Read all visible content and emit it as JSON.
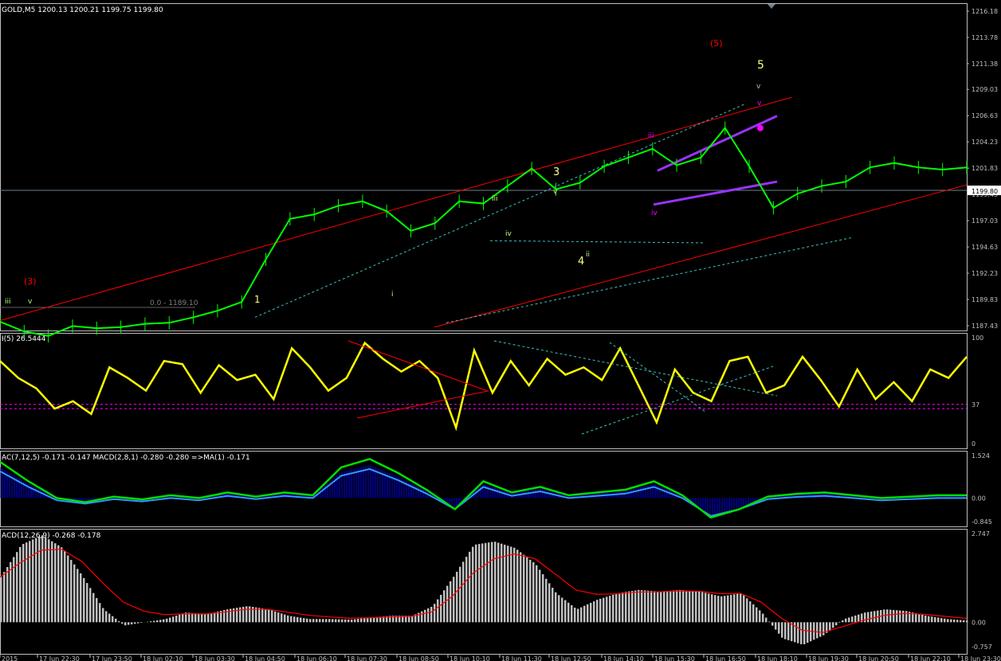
{
  "window": {
    "symbol_header": "GOLD,M5  1200.13 1200.21 1199.75 1199.80",
    "current_price_tag": "1199.80"
  },
  "colors": {
    "background": "#000000",
    "frame": "#c0c0c0",
    "candles": "#00ff00",
    "price_line": "#708090",
    "channel": "#ff0000",
    "dotted_trend": "#40c0c0",
    "wedge": "#9933ff",
    "rsi_line": "#ffff00",
    "rsi_level": "#ff00ff",
    "macd_signal": "#00e000",
    "macd_fast": "#3399ff",
    "macd_hist": "#0000ff",
    "macd2_hist": "#c0c0c0",
    "macd2_signal": "#ff0000"
  },
  "chart_data": [
    {
      "type": "line",
      "panel": "price",
      "ylim": [
        1187.43,
        1216.18
      ],
      "y_ticks": [
        "1216.18",
        "1213.78",
        "1211.38",
        "1209.03",
        "1206.63",
        "1204.23",
        "1201.83",
        "1199.43",
        "1197.03",
        "1194.63",
        "1192.23",
        "1189.83",
        "1187.43"
      ],
      "x": [
        0,
        5,
        10,
        15,
        20,
        25,
        30,
        35,
        40,
        45,
        50,
        55,
        60,
        65,
        70,
        75,
        80,
        85,
        90,
        95,
        100,
        105,
        110,
        115,
        120,
        125,
        130,
        135,
        140,
        145,
        150,
        155,
        160,
        165,
        170,
        175,
        180,
        185,
        190,
        195,
        200
      ],
      "close": [
        1187.8,
        1186.9,
        1186.5,
        1187.4,
        1187.2,
        1187.3,
        1187.6,
        1187.7,
        1188.2,
        1188.8,
        1189.6,
        1193.5,
        1197.2,
        1197.6,
        1198.4,
        1198.8,
        1197.9,
        1196.1,
        1196.8,
        1198.8,
        1198.6,
        1200.2,
        1201.8,
        1199.9,
        1200.5,
        1202.0,
        1202.8,
        1203.6,
        1202.1,
        1202.8,
        1205.5,
        1202.0,
        1198.2,
        1199.5,
        1200.2,
        1200.6,
        1201.9,
        1202.3,
        1201.9,
        1201.7,
        1201.9
      ],
      "fib_label": "0.0 - 1189.10",
      "wave_labels": [
        "(3)",
        "(5)",
        "1",
        "3",
        "4",
        "5",
        "i",
        "ii",
        "iii",
        "iv",
        "v"
      ]
    },
    {
      "type": "line",
      "panel": "rsi",
      "title": "I(5) 26.5444",
      "ylim": [
        0,
        100
      ],
      "y_ticks": [
        "100",
        "37",
        "0"
      ],
      "levels": [
        37,
        33
      ],
      "values": [
        78,
        62,
        52,
        33,
        40,
        28,
        72,
        62,
        50,
        78,
        75,
        48,
        74,
        60,
        65,
        42,
        90,
        72,
        50,
        62,
        95,
        80,
        68,
        78,
        62,
        15,
        88,
        48,
        78,
        55,
        80,
        65,
        72,
        60,
        90,
        55,
        20,
        70,
        48,
        40,
        78,
        82,
        48,
        55,
        82,
        60,
        35,
        70,
        42,
        58,
        40,
        70,
        62,
        82
      ]
    },
    {
      "type": "line",
      "panel": "macd_small",
      "title": "AC(7,12,5) -0.171 -0.147  MACD(2,8,1) -0.280 -0.280  =>MA(1) -0.171",
      "ylim": [
        -0.845,
        1.524
      ],
      "y_ticks": [
        "1.524",
        "0.00",
        "-0.845"
      ],
      "values": [
        1.3,
        0.6,
        0.0,
        -0.15,
        0.05,
        -0.05,
        0.1,
        0.0,
        0.2,
        0.05,
        0.2,
        0.1,
        1.1,
        1.4,
        0.9,
        0.3,
        -0.4,
        0.6,
        0.2,
        0.4,
        0.1,
        0.2,
        0.3,
        0.6,
        0.1,
        -0.7,
        -0.4,
        0.05,
        0.15,
        0.2,
        0.1,
        0.0,
        0.05,
        0.1,
        0.1
      ]
    },
    {
      "type": "bar",
      "panel": "macd",
      "title": "ACD(12,26,9) -0.268 -0.178",
      "ylim": [
        -0.757,
        2.747
      ],
      "y_ticks": [
        "2.747",
        "0.00",
        "-0.757"
      ],
      "values": [
        1.4,
        2.4,
        2.7,
        2.3,
        1.4,
        0.4,
        -0.1,
        0.0,
        0.1,
        0.3,
        0.25,
        0.4,
        0.5,
        0.4,
        0.2,
        0.1,
        0.1,
        0.08,
        0.15,
        0.2,
        0.2,
        0.5,
        1.4,
        2.4,
        2.5,
        2.3,
        1.8,
        0.9,
        0.4,
        0.7,
        0.9,
        1.0,
        0.95,
        1.0,
        0.95,
        0.8,
        0.9,
        0.3,
        -0.5,
        -0.7,
        -0.4,
        0.1,
        0.3,
        0.4,
        0.35,
        0.2,
        0.1,
        0.05
      ]
    }
  ],
  "x_axis": {
    "labels": [
      "2015",
      "17 Jun 22:30",
      "17 Jun 23:50",
      "18 Jun 02:10",
      "18 Jun 03:30",
      "18 Jun 04:50",
      "18 Jun 06:10",
      "18 Jun 07:30",
      "18 Jun 08:50",
      "18 Jun 10:10",
      "18 Jun 11:30",
      "18 Jun 12:50",
      "18 Jun 14:10",
      "18 Jun 15:30",
      "18 Jun 16:50",
      "18 Jun 18:10",
      "18 Jun 19:30",
      "18 Jun 20:50",
      "18 Jun 22:10",
      "18 Jun 23:30"
    ]
  }
}
